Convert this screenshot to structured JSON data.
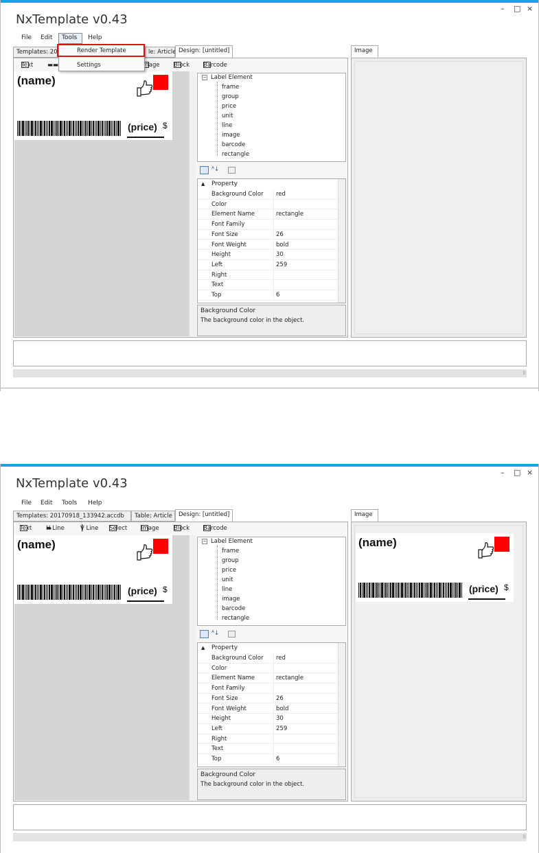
{
  "app": {
    "title": "NxTemplate v0.43",
    "controls": {
      "minimize": "–",
      "maximize": "□",
      "close": "×"
    }
  },
  "menu": [
    "File",
    "Edit",
    "Tools",
    "Help"
  ],
  "tools_menu": {
    "render": "Render Template",
    "settings": "Settings"
  },
  "tabs": {
    "templates": "Templates: 20170918_133942.accdb",
    "templates_clipped": "Templates: 20",
    "table": "Table: Article",
    "table_clipped": "le: Article",
    "design": "Design: [untitled]",
    "image": "Image"
  },
  "toolbar": {
    "text": "Text",
    "hline": "H Line",
    "vline": "V Line",
    "select": "Select",
    "image": "Image",
    "block": "Block",
    "barcode": "Barcode"
  },
  "label": {
    "name": "(name)",
    "price": "(price)",
    "currency": "$"
  },
  "tree": {
    "root": "Label Element",
    "items": [
      "frame",
      "group",
      "price",
      "unit",
      "line",
      "image",
      "barcode",
      "rectangle"
    ]
  },
  "property_grid": {
    "category": "Property",
    "rows": [
      {
        "name": "Background Color",
        "value": "red"
      },
      {
        "name": "Color",
        "value": ""
      },
      {
        "name": "Element Name",
        "value": "rectangle"
      },
      {
        "name": "Font Family",
        "value": ""
      },
      {
        "name": "Font Size",
        "value": "26"
      },
      {
        "name": "Font Weight",
        "value": "bold"
      },
      {
        "name": "Height",
        "value": "30"
      },
      {
        "name": "Left",
        "value": "259"
      },
      {
        "name": "Right",
        "value": ""
      },
      {
        "name": "Text",
        "value": ""
      },
      {
        "name": "Top",
        "value": "6"
      }
    ],
    "desc_title": "Background Color",
    "desc_text": "The background color in the object."
  },
  "colors": {
    "accent": "#1aa0e6",
    "highlight": "#e01010",
    "rect": "#ff0000"
  }
}
